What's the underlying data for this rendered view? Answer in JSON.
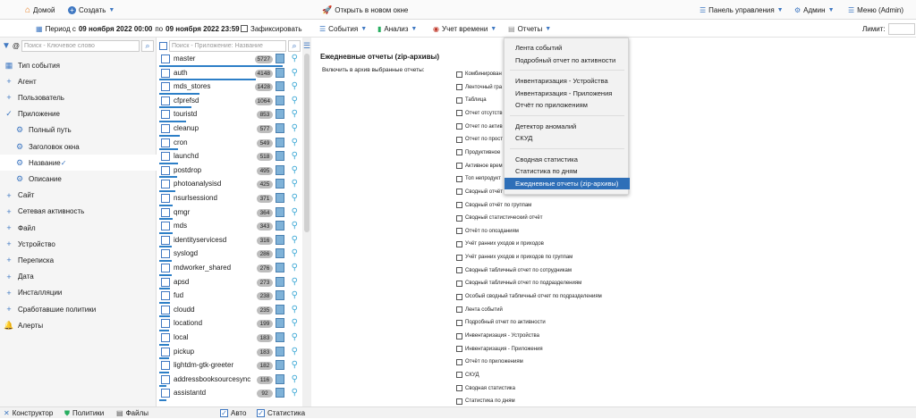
{
  "topbar": {
    "home_label": "Домой",
    "create_label": "Создать",
    "open_new_window": "Открыть в новом окне",
    "control_panel": "Панель управления",
    "admin": "Админ",
    "menu": "Меню (Admin)"
  },
  "toolbar2": {
    "period_prefix": "Период с",
    "period_from": "09 ноября 2022 00:00",
    "period_mid": "по",
    "period_to": "09 ноября 2022 23:59",
    "fixed_label": "Зафиксировать",
    "events": "События",
    "analysis": "Анализ",
    "time_tracking": "Учет времени",
    "reports": "Отчеты",
    "limit_label": "Лимит:"
  },
  "left": {
    "search_prefix": "@",
    "search_placeholder": "Поиск - Ключевое слово",
    "items": [
      {
        "label": "Тип события",
        "mark": "icon"
      },
      {
        "label": "Агент",
        "mark": "+"
      },
      {
        "label": "Пользователь",
        "mark": "+"
      },
      {
        "label": "Приложение",
        "mark": "check"
      },
      {
        "label": "Полный путь",
        "mark": "sub"
      },
      {
        "label": "Заголовок окна",
        "mark": "sub"
      },
      {
        "label": "Название",
        "mark": "sub-selected"
      },
      {
        "label": "Описание",
        "mark": "sub"
      },
      {
        "label": "Сайт",
        "mark": "+"
      },
      {
        "label": "Сетевая активность",
        "mark": "+"
      },
      {
        "label": "Файл",
        "mark": "+"
      },
      {
        "label": "Устройство",
        "mark": "+"
      },
      {
        "label": "Переписка",
        "mark": "+"
      },
      {
        "label": "Дата",
        "mark": "+"
      },
      {
        "label": "Инсталляции",
        "mark": "+"
      },
      {
        "label": "Сработавшие политики",
        "mark": "+"
      },
      {
        "label": "Алерты",
        "mark": "bell"
      }
    ]
  },
  "middle": {
    "search_placeholder": "Поиск - Приложение: Название",
    "items": [
      {
        "name": "master",
        "count": "5727",
        "bar": 0.92
      },
      {
        "name": "auth",
        "count": "4148",
        "bar": 0.72
      },
      {
        "name": "mds_stores",
        "count": "1428",
        "bar": 0.3
      },
      {
        "name": "cfprefsd",
        "count": "1064",
        "bar": 0.24
      },
      {
        "name": "touristd",
        "count": "853",
        "bar": 0.2
      },
      {
        "name": "cleanup",
        "count": "577",
        "bar": 0.15
      },
      {
        "name": "cron",
        "count": "549",
        "bar": 0.14
      },
      {
        "name": "launchd",
        "count": "518",
        "bar": 0.14
      },
      {
        "name": "postdrop",
        "count": "495",
        "bar": 0.13
      },
      {
        "name": "photoanalysisd",
        "count": "425",
        "bar": 0.12
      },
      {
        "name": "nsurlsessiond",
        "count": "371",
        "bar": 0.1
      },
      {
        "name": "qmgr",
        "count": "364",
        "bar": 0.1
      },
      {
        "name": "mds",
        "count": "343",
        "bar": 0.1
      },
      {
        "name": "identityservicesd",
        "count": "316",
        "bar": 0.09
      },
      {
        "name": "syslogd",
        "count": "286",
        "bar": 0.09
      },
      {
        "name": "mdworker_shared",
        "count": "276",
        "bar": 0.09
      },
      {
        "name": "apsd",
        "count": "273",
        "bar": 0.08
      },
      {
        "name": "fud",
        "count": "238",
        "bar": 0.08
      },
      {
        "name": "cloudd",
        "count": "235",
        "bar": 0.08
      },
      {
        "name": "locationd",
        "count": "199",
        "bar": 0.07
      },
      {
        "name": "local",
        "count": "183",
        "bar": 0.07
      },
      {
        "name": "pickup",
        "count": "183",
        "bar": 0.07
      },
      {
        "name": "lightdm-gtk-greeter",
        "count": "182",
        "bar": 0.07
      },
      {
        "name": "addressbooksourcesync",
        "count": "116",
        "bar": 0.05
      },
      {
        "name": "assistantd",
        "count": "92",
        "bar": 0.05
      }
    ]
  },
  "content": {
    "title": "Ежедневные отчеты (zip-архивы)",
    "include_label": "Включить в архив выбранные отчеты:",
    "reports": [
      "Комбинирован",
      "Ленточный гра",
      "Таблица",
      "Отчет отсутств",
      "Отчет по актив",
      "Отчет по прост",
      "Продуктивное",
      "Активное врем",
      "Топ непродукт",
      "Сводный отчёт",
      "Сводный отчёт по группам",
      "Сводный статистический отчёт",
      "Отчёт по опозданиям",
      "Учёт ранних уходов и приходов",
      "Учёт ранних уходов и приходов по группам",
      "Сводный табличный отчет по сотрудникам",
      "Сводный табличный отчет по подразделениям",
      "Особый сводный табличный отчет по подразделениям",
      "Лента событий",
      "Подробный отчет по активности",
      "Инвентаризация - Устройства",
      "Инвентаризация - Приложения",
      "Отчёт по приложениям",
      "СКУД",
      "Сводная статистика",
      "Статистика по дням"
    ]
  },
  "dropdown": {
    "groups": [
      [
        "Лента событий",
        "Подробный отчет по активности"
      ],
      [
        "Инвентаризация - Устройства",
        "Инвентаризация - Приложения",
        "Отчёт по приложениям"
      ],
      [
        "Детектор аномалий",
        "СКУД"
      ],
      [
        "Сводная статистика",
        "Статистика по дням",
        "Ежедневные отчеты (zip-архивы)"
      ]
    ],
    "active": "Ежедневные отчеты (zip-архивы)"
  },
  "bottombar": {
    "constructor": "Конструктор",
    "policies": "Политики",
    "files": "Файлы",
    "auto": "Авто",
    "statistics": "Статистика"
  },
  "colors": {
    "accent": "#2e6fb8",
    "bar": "#2d7fc7",
    "badge": "#bdbdbd"
  }
}
